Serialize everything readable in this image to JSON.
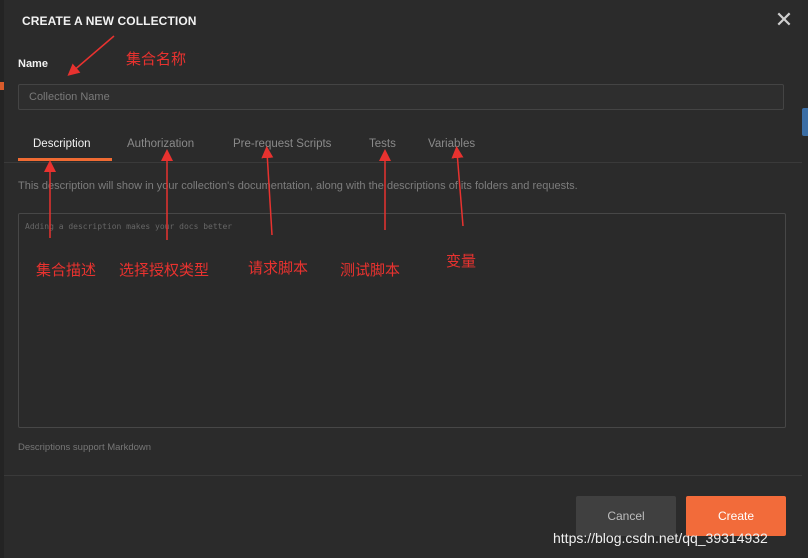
{
  "dialog": {
    "title": "CREATE A NEW COLLECTION",
    "close_glyph": "✕"
  },
  "name_field": {
    "label": "Name",
    "placeholder": "Collection Name",
    "value": ""
  },
  "tabs": [
    {
      "label": "Description",
      "active": true
    },
    {
      "label": "Authorization",
      "active": false
    },
    {
      "label": "Pre-request Scripts",
      "active": false
    },
    {
      "label": "Tests",
      "active": false
    },
    {
      "label": "Variables",
      "active": false
    }
  ],
  "description": {
    "hint": "This description will show in your collection's documentation, along with the descriptions of its folders and requests.",
    "placeholder": "Adding a description makes your docs better",
    "markdown_note": "Descriptions support Markdown"
  },
  "buttons": {
    "cancel": "Cancel",
    "create": "Create"
  },
  "annotations": {
    "name": "集合名称",
    "description": "集合描述",
    "authorization": "选择授权类型",
    "prerequest": "请求脚本",
    "tests": "测试脚本",
    "variables": "变量"
  },
  "watermark": "https://blog.csdn.net/qq_39314932",
  "colors": {
    "accent": "#f26b3a",
    "annotation": "#e8322f",
    "background": "#2b2b2b"
  }
}
